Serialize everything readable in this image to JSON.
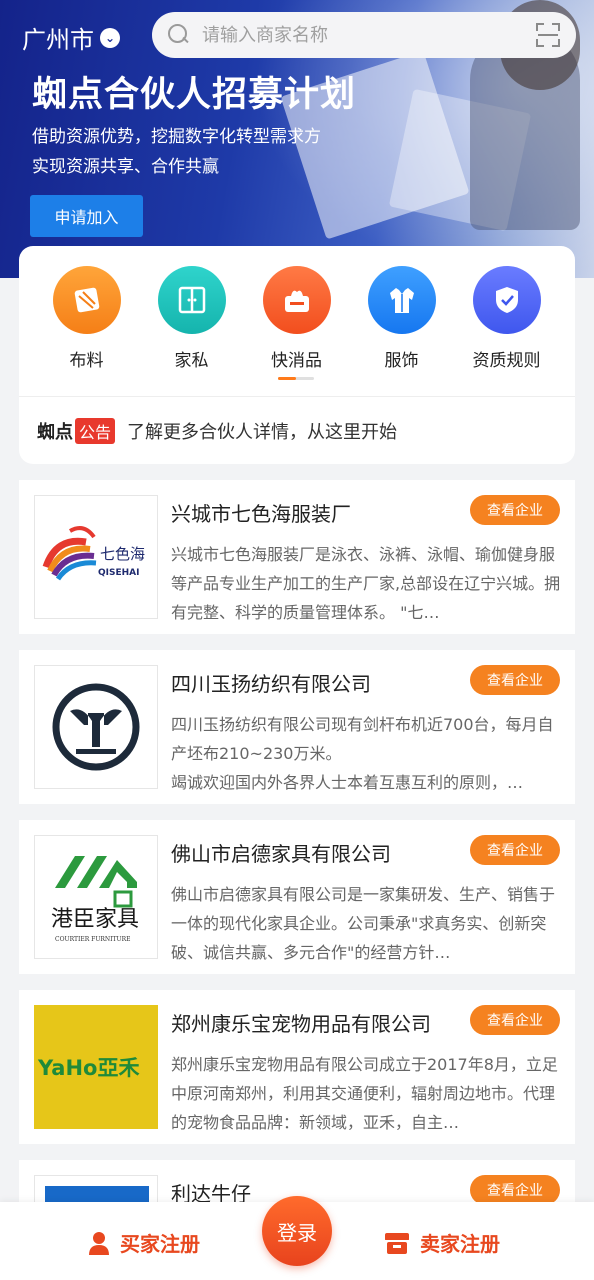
{
  "header": {
    "city": "广州市",
    "search_placeholder": "请输入商家名称"
  },
  "banner": {
    "title": "蜘点合伙人招募计划",
    "subtitle_line1": "借助资源优势，挖掘数字化转型需求方",
    "subtitle_line2": "实现资源共享、合作共赢",
    "button": "申请加入"
  },
  "categories": [
    {
      "label": "布料",
      "icon": "fabric-icon",
      "color": "#f57f17"
    },
    {
      "label": "家私",
      "icon": "furniture-icon",
      "color": "#15b4ad"
    },
    {
      "label": "快消品",
      "icon": "tissue-box-icon",
      "color": "#f24e1e"
    },
    {
      "label": "服饰",
      "icon": "shirt-icon",
      "color": "#1677f0"
    },
    {
      "label": "资质规则",
      "icon": "shield-check-icon",
      "color": "#3f57ee"
    }
  ],
  "notice": {
    "brand": "蜘点",
    "tag": "公告",
    "text": "了解更多合伙人详情，从这里开始"
  },
  "companies": [
    {
      "name": "兴城市七色海服装厂",
      "button": "查看企业",
      "description": "兴城市七色海服装厂是泳衣、泳裤、泳帽、瑜伽健身服等产品专业生产加工的生产厂家,总部设在辽宁兴城。拥有完整、科学的质量管理体系。 \"七…",
      "logo_text": "七色海",
      "logo_sub": "QISEHAI"
    },
    {
      "name": "四川玉扬纺织有限公司",
      "button": "查看企业",
      "description": "四川玉扬纺织有限公司现有剑杆布机近700台，每月自产坯布210~230万米。\n竭诚欢迎国内外各界人士本着互惠互利的原则，…"
    },
    {
      "name": "佛山市启德家具有限公司",
      "button": "查看企业",
      "description": "佛山市启德家具有限公司是一家集研发、生产、销售于一体的现代化家具企业。公司秉承\"求真务实、创新突破、诚信共赢、多元合作\"的经营方针…",
      "logo_text": "港臣家具",
      "logo_sub": "COURTIER FURNITURE"
    },
    {
      "name": "郑州康乐宝宠物用品有限公司",
      "button": "查看企业",
      "description": "郑州康乐宝宠物用品有限公司成立于2017年8月，立足中原河南郑州，利用其交通便利，辐射周边地市。代理的宠物食品品牌：新领域，亚禾，自主…",
      "logo_text": "YaHo亞禾"
    },
    {
      "name": "利达牛仔",
      "button": "查看企业",
      "description": ""
    }
  ],
  "bottom_nav": {
    "buyer": "买家注册",
    "login": "登录",
    "seller": "卖家注册"
  }
}
